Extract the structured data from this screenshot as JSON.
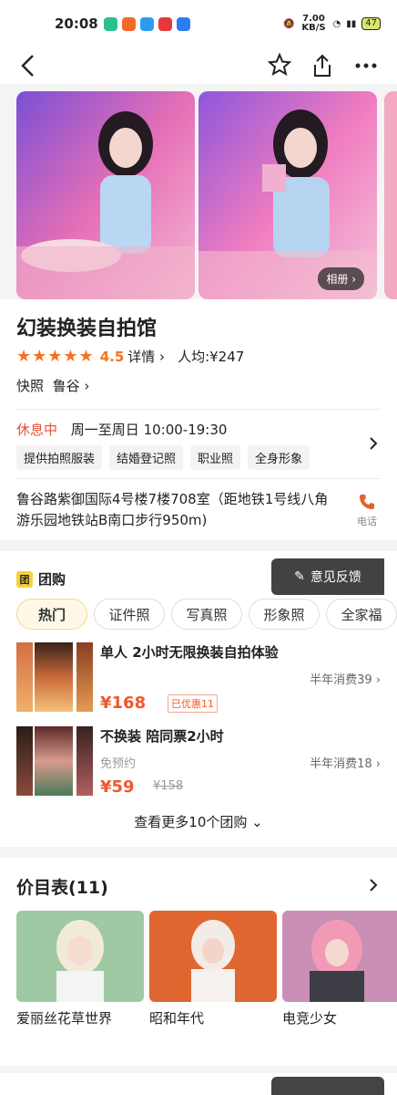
{
  "status_bar": {
    "time": "20:08",
    "speed": "7.00 KB/S",
    "battery": "47"
  },
  "shop": {
    "name": "幻装换装自拍馆",
    "rating_stars": "★★★★★",
    "rating": "4.5",
    "details_link": "详情",
    "avg_price": "人均:¥247",
    "category": "快照",
    "district": "鲁谷",
    "status": "休息中",
    "hours": "周一至周日 10:00-19:30",
    "tags": [
      "提供拍照服装",
      "结婚登记照",
      "职业照",
      "全身形象"
    ],
    "address": "鲁谷路紫御国际4号楼7楼708室（距地铁1号线八角游乐园地铁站B南口步行950m)",
    "phone_label": "电话"
  },
  "gallery": {
    "album_label": "相册"
  },
  "group_buy": {
    "icon_text": "团",
    "title": "团购",
    "feedback_label": "意见反馈",
    "tabs": [
      "热门",
      "证件照",
      "写真照",
      "形象照",
      "全家福"
    ],
    "deals": [
      {
        "title": "单人 2小时无限换装自拍体验",
        "sold": "半年消费39",
        "sub": "",
        "price": "¥168",
        "discount": "已优惠11",
        "orig": ""
      },
      {
        "title": "不换装 陪同票2小时",
        "sold": "半年消费18",
        "sub": "免预约",
        "price": "¥59",
        "discount": "",
        "orig": "¥158"
      }
    ],
    "see_more": "查看更多10个团购"
  },
  "price_list": {
    "title": "价目表(11)",
    "items": [
      {
        "name": "爱丽丝花草世界"
      },
      {
        "name": "昭和年代"
      },
      {
        "name": "电竞少女"
      }
    ]
  },
  "colors": {
    "accent": "#f5731f",
    "price": "#f0582a",
    "closed": "#e4533b",
    "phone": "#e8612c"
  }
}
